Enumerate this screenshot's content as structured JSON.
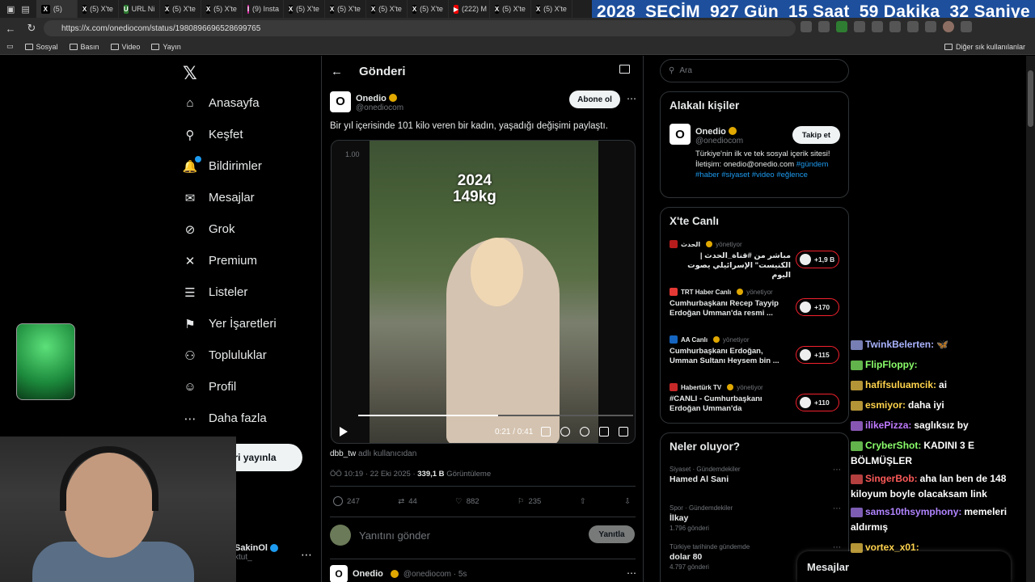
{
  "browser": {
    "tabs": [
      {
        "label": "(5)",
        "fav": "X",
        "color": "#000"
      },
      {
        "label": "(5) X'te",
        "fav": "X",
        "color": "#000"
      },
      {
        "label": "URL Ni",
        "fav": "U",
        "color": "#2e7d32"
      },
      {
        "label": "(5) X'te",
        "fav": "X",
        "color": "#000"
      },
      {
        "label": "(5) X'te",
        "fav": "X",
        "color": "#000"
      },
      {
        "label": "(9) Insta",
        "fav": "I",
        "color": "#d6249f"
      },
      {
        "label": "(5) X'te",
        "fav": "X",
        "color": "#000"
      },
      {
        "label": "(5) X'te",
        "fav": "X",
        "color": "#000"
      },
      {
        "label": "(5) X'te",
        "fav": "X",
        "color": "#000"
      },
      {
        "label": "(5) X'te",
        "fav": "X",
        "color": "#000"
      },
      {
        "label": "(222) M",
        "fav": "▶",
        "color": "#e00"
      },
      {
        "label": "(5) X'te",
        "fav": "X",
        "color": "#000"
      },
      {
        "label": "(5) X'te",
        "fav": "X",
        "color": "#000"
      }
    ],
    "url": "https://x.com/onediocom/status/1980896696528699765",
    "bookmarks": [
      "Sosyal",
      "Basın",
      "Video",
      "Yayın"
    ],
    "bookmarks_right": "Diğer sık kullanılanlar"
  },
  "countdown": [
    "2028",
    "SEÇİM",
    "927 Gün",
    "15 Saat",
    "59 Dakika",
    "32 Saniye"
  ],
  "nav": {
    "items": [
      {
        "label": "Anasayfa",
        "icon": "home-icon",
        "glyph": "⌂"
      },
      {
        "label": "Keşfet",
        "icon": "search-icon",
        "glyph": "⚲"
      },
      {
        "label": "Bildirimler",
        "icon": "bell-icon",
        "glyph": "🔔"
      },
      {
        "label": "Mesajlar",
        "icon": "mail-icon",
        "glyph": "✉"
      },
      {
        "label": "Grok",
        "icon": "grok-icon",
        "glyph": "⊘"
      },
      {
        "label": "Premium",
        "icon": "x-premium-icon",
        "glyph": "✕"
      },
      {
        "label": "Listeler",
        "icon": "list-icon",
        "glyph": "☰"
      },
      {
        "label": "Yer İşaretleri",
        "icon": "bookmark-icon",
        "glyph": "⚑"
      },
      {
        "label": "Topluluklar",
        "icon": "communities-icon",
        "glyph": "⚇"
      },
      {
        "label": "Profil",
        "icon": "profile-icon",
        "glyph": "☺"
      },
      {
        "label": "Daha fazla",
        "icon": "more-icon",
        "glyph": "⋯"
      }
    ],
    "post_button": "Gönderi yayınla",
    "user_name": "SakinOl",
    "user_handle": "ktut_"
  },
  "post": {
    "header_title": "Gönderi",
    "author_name": "Onedio",
    "author_handle": "@onediocom",
    "subscribe_label": "Abone ol",
    "text": "Bir yıl içerisinde 101 kilo veren bir kadın, yaşadığı değişimi paylaştı.",
    "video": {
      "speed": "1.00",
      "overlay_year": "2024",
      "overlay_weight": "149kg",
      "time": "0:21 / 0:41",
      "progress": 0.51
    },
    "credit_user": "dbb_tw",
    "credit_suffix": "adlı kullanıcıdan",
    "timestamp": "ÖÖ 10:19 · 22 Eki 2025 ·",
    "views_count": "339,1 B",
    "views_label": "Görüntüleme",
    "stats": {
      "replies": "247",
      "reposts": "44",
      "likes": "882",
      "bookmarks": "235"
    },
    "reply_placeholder": "Yanıtını gönder",
    "reply_button": "Yanıtla",
    "next_author": "Onedio",
    "next_handle": "@onediocom · 5s"
  },
  "sidebar": {
    "search_placeholder": "Ara",
    "related": {
      "title": "Alakalı kişiler",
      "name": "Onedio",
      "handle": "@onediocom",
      "follow": "Takip et",
      "bio": "Türkiye'nin ilk ve tek sosyal içerik sitesi! İletişim: onedio@onedio.com",
      "tags": "#gündem #haber #siyaset #video #eğlence"
    },
    "live": {
      "title": "X'te Canlı",
      "items": [
        {
          "channel": "الحدث",
          "status": "yönetiyor",
          "title": "مباشر من #قناة_الحدث | الكنيست\" الإسرائيلي يصوت اليوم",
          "count": "+1,9 B",
          "color": "#b71c1c"
        },
        {
          "channel": "TRT Haber Canlı",
          "status": "yönetiyor",
          "title": "Cumhurbaşkanı Recep Tayyip Erdoğan Umman'da resmi ...",
          "count": "+170",
          "color": "#e53935"
        },
        {
          "channel": "AA Canlı",
          "status": "yönetiyor",
          "title": "Cumhurbaşkanı Erdoğan, Umman Sultanı Heysem bin ...",
          "count": "+115",
          "color": "#1565c0"
        },
        {
          "channel": "Habertürk TV",
          "status": "yönetiyor",
          "title": "#CANLI - Cumhurbaşkanı Erdoğan Umman'da",
          "count": "+110",
          "color": "#c62828"
        }
      ]
    },
    "trends": {
      "title": "Neler oluyor?",
      "items": [
        {
          "category": "Siyaset · Gündemdekiler",
          "title": "Hamed Al Sani",
          "count": ""
        },
        {
          "category": "Spor · Gündemdekiler",
          "title": "İlkay",
          "count": "1.796 gönderi"
        },
        {
          "category": "Türkiye tarihinde gündemde",
          "title": "dolar 80",
          "count": "4.797 gönderi"
        }
      ]
    },
    "messages_label": "Mesajlar"
  },
  "chat": [
    {
      "user": "TwinkBelerten:",
      "msg": "🦋",
      "color": "#aab4ff"
    },
    {
      "user": "FlipFloppy:",
      "msg": "",
      "color": "#8bff6b"
    },
    {
      "user": "hafifsuluamcik:",
      "msg": "ai",
      "color": "#ffd34d"
    },
    {
      "user": "esmiyor:",
      "msg": "daha iyi",
      "color": "#ffd34d"
    },
    {
      "user": "ilikePizza:",
      "msg": "saglıksız by",
      "color": "#c07bff"
    },
    {
      "user": "CryberShot:",
      "msg": "KADINI 3 E BÖLMÜŞLER",
      "color": "#8bff6b"
    },
    {
      "user": "SingerBob:",
      "msg": "aha lan ben de 148 kiloyum boyle olacaksam link",
      "color": "#ff5a5a"
    },
    {
      "user": "sams10thsymphony:",
      "msg": "memeleri aldırmış",
      "color": "#b084ff"
    },
    {
      "user": "vortex_x01:",
      "msg": "",
      "color": "#ffd34d"
    }
  ]
}
